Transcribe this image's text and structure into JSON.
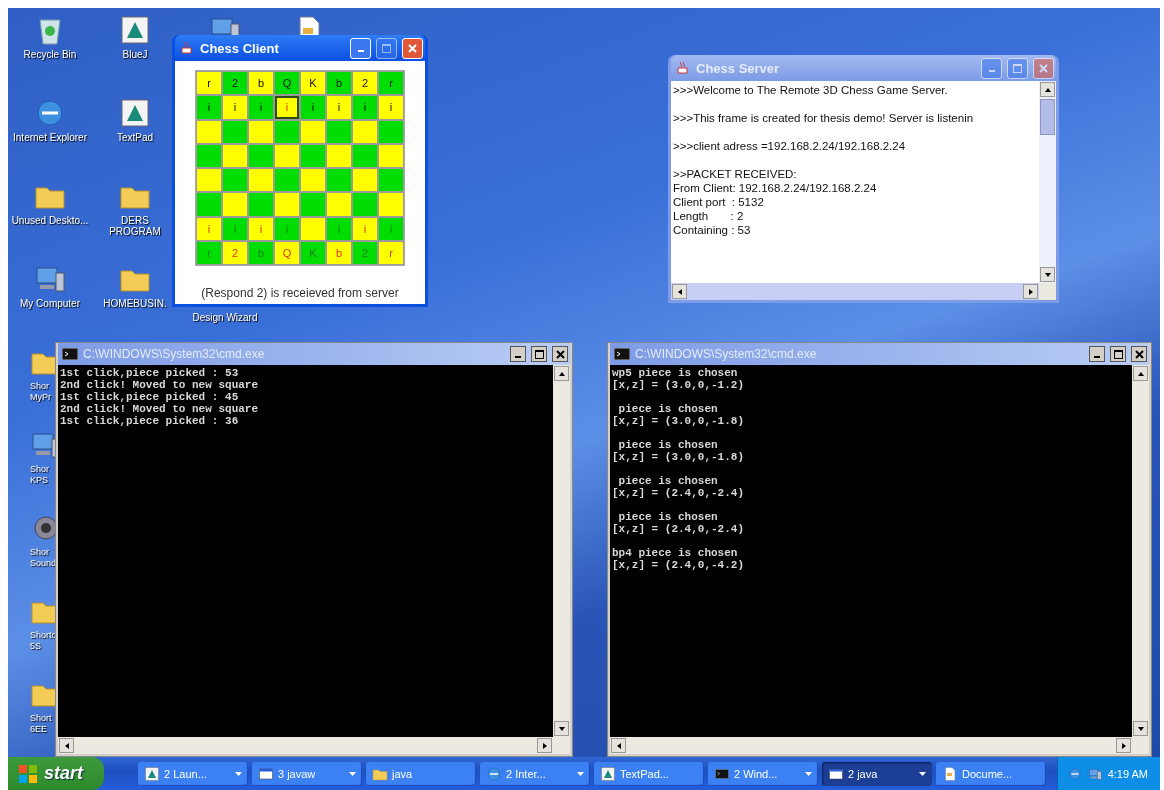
{
  "desktop": {
    "icon_columns": [
      [
        {
          "kind": "icon",
          "label": "Recycle Bin"
        },
        {
          "kind": "icon",
          "label": "Internet Explorer"
        },
        {
          "kind": "icon",
          "label": "Unused Deskto..."
        },
        {
          "kind": "icon",
          "label": "My Computer"
        },
        {
          "kind": "shortcut",
          "label": "Shor MyPr"
        },
        {
          "kind": "shortcut",
          "label": "Shor KPS"
        },
        {
          "kind": "shortcut",
          "label": "Shor Sound"
        },
        {
          "kind": "shortcut",
          "label": "Shortc 5S"
        },
        {
          "kind": "shortcut",
          "label": "Short 6EE"
        }
      ],
      [
        {
          "kind": "icon",
          "label": "BlueJ"
        },
        {
          "kind": "icon",
          "label": "TextPad"
        },
        {
          "kind": "icon",
          "label": "DERS PROGRAM"
        },
        {
          "kind": "icon",
          "label": "HOMEBUSIN."
        }
      ],
      [
        {
          "kind": "icon"
        },
        {
          "kind": "label_only",
          "label": "Design Wizard"
        }
      ],
      [
        {
          "kind": "icon"
        }
      ]
    ]
  },
  "chess_client": {
    "title": "Chess Client",
    "active": true,
    "status": "(Respond 2) is receieved from server",
    "board": [
      [
        {
          "piece": "r",
          "selected": false
        },
        {
          "piece": "2",
          "selected": false
        },
        {
          "piece": "b",
          "selected": false
        },
        {
          "piece": "Q",
          "selected": false
        },
        {
          "piece": "K",
          "selected": false
        },
        {
          "piece": "b",
          "selected": false
        },
        {
          "piece": "2",
          "selected": false
        },
        {
          "piece": "r",
          "selected": false
        }
      ],
      [
        {
          "piece": "i",
          "selected": false
        },
        {
          "piece": "i",
          "selected": false
        },
        {
          "piece": "i",
          "selected": false
        },
        {
          "piece": "i",
          "selected": true
        },
        {
          "piece": "i",
          "selected": false
        },
        {
          "piece": "i",
          "selected": false
        },
        {
          "piece": "i",
          "selected": false
        },
        {
          "piece": "i",
          "selected": false
        }
      ],
      [
        {
          "selected": false
        },
        {
          "selected": false
        },
        {
          "selected": false
        },
        {
          "selected": false
        },
        {
          "selected": false
        },
        {
          "selected": false
        },
        {
          "selected": false
        },
        {
          "selected": false
        }
      ],
      [
        {
          "selected": false
        },
        {
          "selected": false
        },
        {
          "selected": false
        },
        {
          "selected": false
        },
        {
          "selected": false
        },
        {
          "selected": false
        },
        {
          "selected": false
        },
        {
          "selected": false
        }
      ],
      [
        {
          "selected": false
        },
        {
          "selected": false
        },
        {
          "selected": false
        },
        {
          "selected": false
        },
        {
          "selected": false
        },
        {
          "selected": false
        },
        {
          "selected": false
        },
        {
          "selected": false
        }
      ],
      [
        {
          "selected": false
        },
        {
          "selected": false
        },
        {
          "selected": false
        },
        {
          "selected": false
        },
        {
          "selected": false
        },
        {
          "selected": false
        },
        {
          "selected": false
        },
        {
          "selected": false
        }
      ],
      [
        {
          "piece": "i",
          "selected": false
        },
        {
          "piece": "i",
          "selected": false
        },
        {
          "piece": "i",
          "selected": false
        },
        {
          "piece": "i",
          "selected": false
        },
        {
          "selected": false
        },
        {
          "piece": "i",
          "selected": false
        },
        {
          "piece": "i",
          "selected": false
        },
        {
          "piece": "i",
          "selected": false
        }
      ],
      [
        {
          "piece": "r",
          "selected": false
        },
        {
          "piece": "2",
          "selected": false
        },
        {
          "piece": "b",
          "selected": false
        },
        {
          "piece": "Q",
          "selected": false
        },
        {
          "piece": "K",
          "selected": false
        },
        {
          "piece": "b",
          "selected": false
        },
        {
          "piece": "2",
          "selected": false
        },
        {
          "piece": "r",
          "selected": false
        }
      ]
    ]
  },
  "chess_server": {
    "title": "Chess Server",
    "active": false,
    "paragraphs": [
      [
        ">>>Welcome to The Remote 3D Chess Game Server."
      ],
      [
        ">>>This frame is created for thesis demo! Server is listenin"
      ],
      [
        ">>>client adress =192.168.2.24/192.168.2.24"
      ],
      [
        ">>PACKET RECEIVED:",
        "From Client: 192.168.2.24/192.168.2.24",
        "Client port  : 5132",
        "Length       : 2",
        "Containing : 53"
      ]
    ]
  },
  "consoles": [
    {
      "title": "C:\\WINDOWS\\System32\\cmd.exe",
      "active": false,
      "paragraphs": [
        [
          "1st click,piece picked : 53",
          "2nd click! Moved to new square",
          "1st click,piece picked : 45",
          "2nd click! Moved to new square",
          "1st click,piece picked : 36"
        ]
      ]
    },
    {
      "title": "C:\\WINDOWS\\System32\\cmd.exe",
      "active": false,
      "paragraphs": [
        [
          "wp5 piece is chosen",
          "[x,z] = (3.0,0,-1.2)"
        ],
        [
          " piece is chosen",
          "[x,z] = (3.0,0,-1.8)"
        ],
        [
          " piece is chosen",
          "[x,z] = (3.0,0,-1.8)"
        ],
        [
          " piece is chosen",
          "[x,z] = (2.4,0,-2.4)"
        ],
        [
          " piece is chosen",
          "[x,z] = (2.4,0,-2.4)"
        ],
        [
          "bp4 piece is chosen",
          "[x,z] = (2.4,0,-4.2)"
        ]
      ]
    }
  ],
  "taskbar": {
    "start": "start",
    "items": [
      {
        "label": "2 Laun...",
        "grouped": true,
        "selected": false
      },
      {
        "label": "3 javaw",
        "grouped": true,
        "selected": false
      },
      {
        "label": "java",
        "grouped": false,
        "selected": false
      },
      {
        "label": "2 Inter...",
        "grouped": true,
        "selected": false
      },
      {
        "label": "TextPad...",
        "grouped": false,
        "selected": false
      },
      {
        "label": "2 Wind...",
        "grouped": true,
        "selected": false
      },
      {
        "label": "2 java",
        "grouped": true,
        "selected": true
      },
      {
        "label": "Docume...",
        "grouped": false,
        "selected": false
      }
    ],
    "clock": "4:19 AM"
  }
}
